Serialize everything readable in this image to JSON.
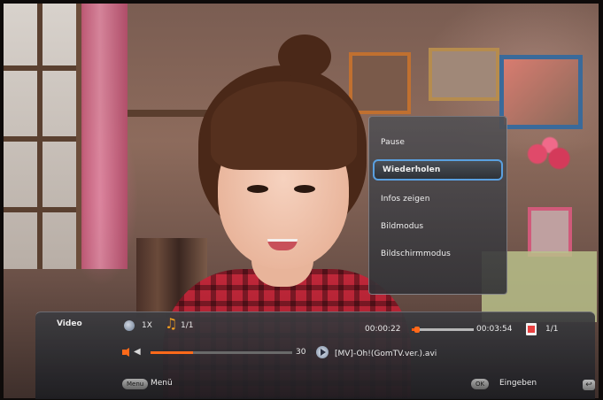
{
  "context_menu": {
    "items": [
      {
        "label": "Pause"
      },
      {
        "label": "Wiederholen",
        "selected": true
      },
      {
        "label": "Infos zeigen"
      },
      {
        "label": "Bildmodus"
      },
      {
        "label": "Bildschirmmodus"
      }
    ]
  },
  "player": {
    "section_label": "Video",
    "speed": "1X",
    "track_count": "1/1",
    "time_elapsed": "00:00:22",
    "time_total": "00:03:54",
    "progress": 0.09,
    "file_count": "1/1",
    "volume": "30",
    "volume_level": 0.3,
    "file_name": "[MV]-Oh!(GomTV.ver.).avi"
  },
  "hints": {
    "menu_key": "Menu",
    "menu_label": "Menü",
    "ok_key": "OK",
    "ok_label": "Eingeben"
  },
  "icons": [
    "speed-icon",
    "music-note-icon",
    "file-icon",
    "volume-icon",
    "play-icon",
    "return-icon"
  ],
  "colors": {
    "accent": "#ff6a1a",
    "selection_border": "#5aa0e0",
    "music_icon": "#f0a020"
  }
}
